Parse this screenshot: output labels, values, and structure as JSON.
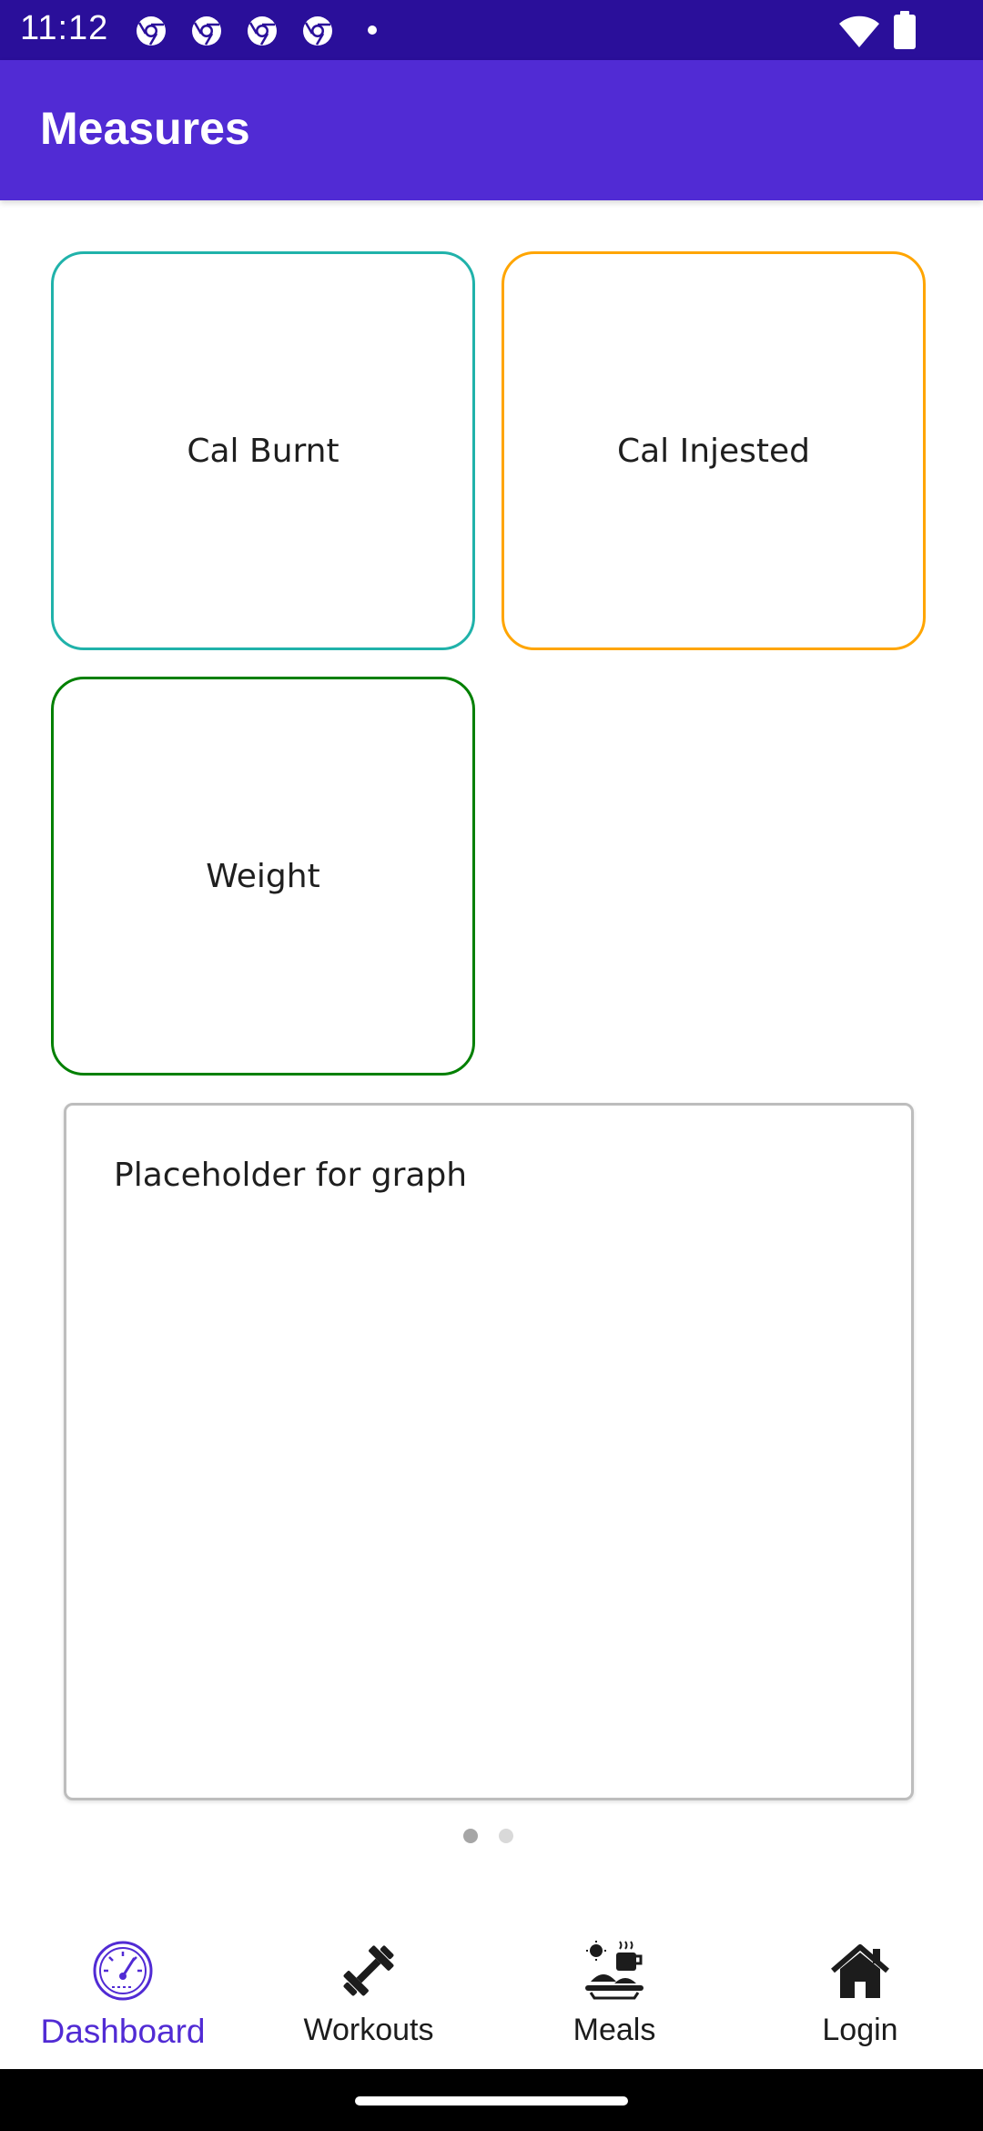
{
  "status_bar": {
    "time": "11:12",
    "notification_icons": [
      "chrome-icon",
      "chrome-icon",
      "chrome-icon",
      "chrome-icon"
    ],
    "system_icons": [
      "wifi-icon",
      "battery-icon"
    ]
  },
  "app_bar": {
    "title": "Measures"
  },
  "tiles": [
    {
      "label": "Cal Burnt",
      "border_color": "#20b2aa"
    },
    {
      "label": "Cal Injested",
      "border_color": "#ffa500"
    },
    {
      "label": "Weight",
      "border_color": "#008000"
    }
  ],
  "graph": {
    "text": "Placeholder for graph"
  },
  "carousel": {
    "pages": 2,
    "current": 1
  },
  "tabs": [
    {
      "label": "Dashboard",
      "icon": "speedometer-icon",
      "active": true
    },
    {
      "label": "Workouts",
      "icon": "dumbbell-icon",
      "active": false
    },
    {
      "label": "Meals",
      "icon": "meal-icon",
      "active": false
    },
    {
      "label": "Login",
      "icon": "home-icon",
      "active": false
    }
  ],
  "colors": {
    "status_bar": "#2a0f9a",
    "primary": "#512bd4",
    "active_tab": "#512bd4"
  }
}
